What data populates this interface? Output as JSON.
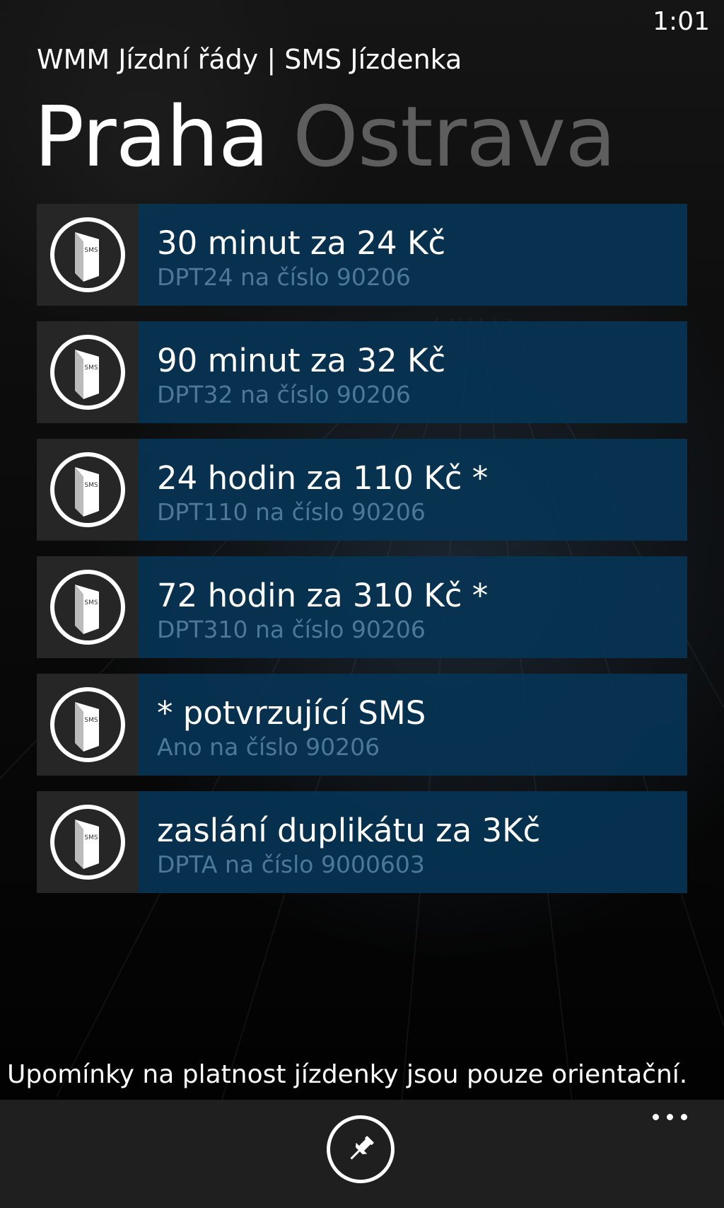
{
  "status": {
    "time": "1:01"
  },
  "app": {
    "title": "WMM Jízdní řády | SMS Jízdenka"
  },
  "pivot": {
    "tabs": [
      {
        "label": "Praha"
      },
      {
        "label": "Ostrava"
      }
    ]
  },
  "tickets": [
    {
      "title": "30 minut za 24 Kč",
      "subtitle": "DPT24 na číslo 90206",
      "icon": "sms-ticket-icon"
    },
    {
      "title": "90 minut za 32 Kč",
      "subtitle": "DPT32 na číslo 90206",
      "icon": "sms-ticket-icon"
    },
    {
      "title": "24 hodin za 110 Kč *",
      "subtitle": "DPT110 na číslo 90206",
      "icon": "sms-ticket-icon"
    },
    {
      "title": "72 hodin za 310 Kč *",
      "subtitle": "DPT310 na číslo 90206",
      "icon": "sms-ticket-icon"
    },
    {
      "title": "* potvrzující SMS",
      "subtitle": "Ano na číslo 90206",
      "icon": "sms-ticket-icon"
    },
    {
      "title": "zaslání duplikátu za 3Kč",
      "subtitle": "DPTA na číslo 9000603",
      "icon": "sms-ticket-icon"
    }
  ],
  "footer": {
    "note": "Upomínky na platnost jízdenky jsou pouze orientační."
  },
  "appbar": {
    "icons": [
      "pin-icon",
      "more-icon"
    ]
  },
  "colors": {
    "tile": "#073454",
    "icon_box": "#262626",
    "subtitle": "#4d7897",
    "inactive_pivot": "#5e5e5e",
    "appbar": "#1f1f1f"
  }
}
